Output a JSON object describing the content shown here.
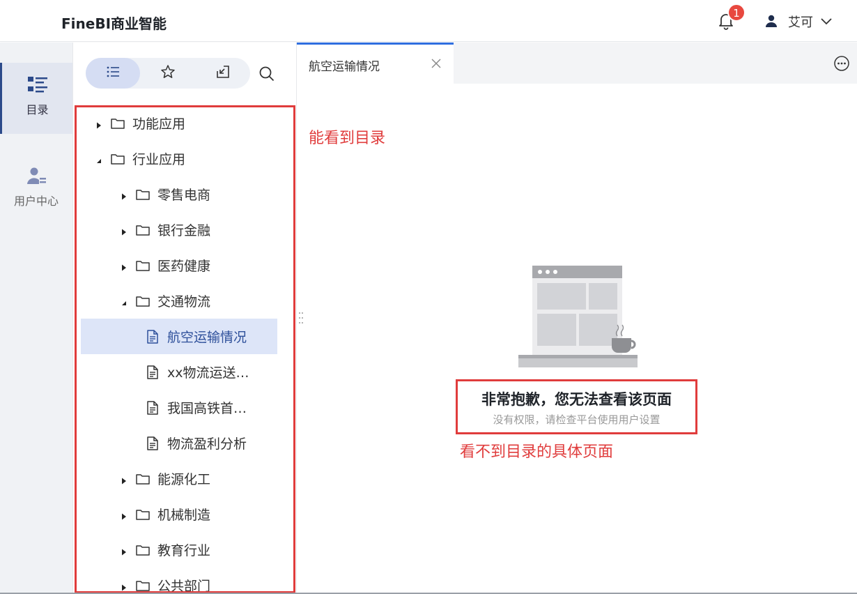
{
  "app": {
    "title": "FineBI商业智能"
  },
  "header": {
    "notification_count": "1",
    "user_name": "艾可"
  },
  "rail": {
    "items": [
      {
        "label": "目录"
      },
      {
        "label": "用户中心"
      }
    ]
  },
  "tree": {
    "items": [
      {
        "label": "功能应用",
        "type": "folder",
        "expanded": false,
        "level": 0
      },
      {
        "label": "行业应用",
        "type": "folder",
        "expanded": true,
        "level": 0
      },
      {
        "label": "零售电商",
        "type": "folder",
        "expanded": false,
        "level": 1
      },
      {
        "label": "银行金融",
        "type": "folder",
        "expanded": false,
        "level": 1
      },
      {
        "label": "医药健康",
        "type": "folder",
        "expanded": false,
        "level": 1
      },
      {
        "label": "交通物流",
        "type": "folder",
        "expanded": true,
        "level": 1
      },
      {
        "label": "航空运输情况",
        "type": "report",
        "selected": true,
        "level": 2
      },
      {
        "label": "xx物流运送…",
        "type": "report",
        "level": 2
      },
      {
        "label": "我国高铁首…",
        "type": "report",
        "level": 2
      },
      {
        "label": "物流盈利分析",
        "type": "report",
        "level": 2
      },
      {
        "label": "能源化工",
        "type": "folder",
        "expanded": false,
        "level": 1
      },
      {
        "label": "机械制造",
        "type": "folder",
        "expanded": false,
        "level": 1
      },
      {
        "label": "教育行业",
        "type": "folder",
        "expanded": false,
        "level": 1
      },
      {
        "label": "公共部门",
        "type": "folder",
        "expanded": false,
        "level": 1
      }
    ]
  },
  "tabs": [
    {
      "label": "航空运输情况"
    }
  ],
  "annotations": {
    "left": "能看到目录",
    "right": "看不到目录的具体页面"
  },
  "error": {
    "title": "非常抱歉，您无法查看该页面",
    "subtitle": "没有权限，请检查平台使用用户设置"
  },
  "colors": {
    "accent": "#2f6fe0",
    "annotation": "#e03c3c",
    "selected_bg": "#dde5f8",
    "badge": "#e8483f"
  }
}
